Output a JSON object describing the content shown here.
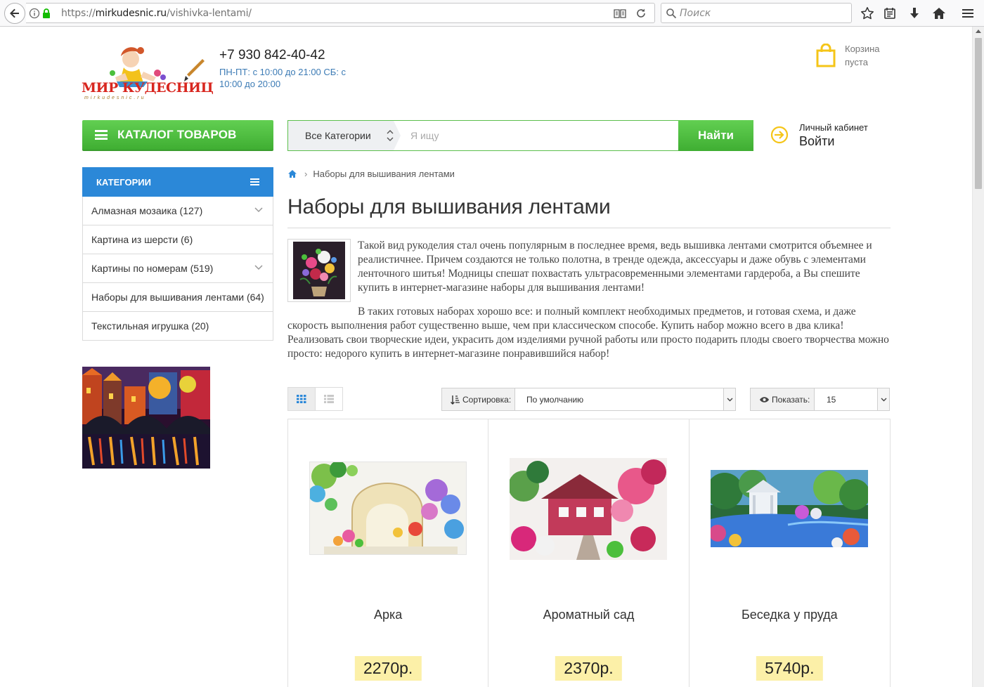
{
  "browser": {
    "url_prefix": "https://",
    "url_domain": "mirkudesnic.ru",
    "url_path": "/vishivka-lentami/",
    "search_placeholder": "Поиск"
  },
  "header": {
    "logo_text": "МИР КУДЕСНИЦ",
    "logo_sub": "mirkudesnic.ru",
    "phone": "+7 930 842-40-42",
    "hours": "ПН-ПТ: с 10:00 до 21:00 СБ: с 10:00 до 20:00",
    "cart_label": "Корзина пуста",
    "catalog_label": "КАТАЛОГ ТОВАРОВ",
    "category_select": "Все Категории",
    "search_placeholder": "Я ищу",
    "find_label": "Найти",
    "cabinet_label": "Личный кабинет",
    "login_label": "Войти"
  },
  "sidebar": {
    "title": "КАТЕГОРИИ",
    "items": [
      {
        "label": "Алмазная мозаика (127)",
        "has_children": true
      },
      {
        "label": "Картина из шерсти (6)",
        "has_children": false
      },
      {
        "label": "Картины по номерам (519)",
        "has_children": true
      },
      {
        "label": "Наборы для вышивания лентами (64)",
        "has_children": false
      },
      {
        "label": "Текстильная игрушка (20)",
        "has_children": false
      }
    ]
  },
  "breadcrumb": {
    "current": "Наборы для вышивания лентами"
  },
  "main": {
    "title": "Наборы для вышивания лентами",
    "desc_p1": "Такой вид рукоделия стал очень популярным в последнее время, ведь вышивка лентами смотрится объемнее и реалистичнее. Причем создаются не только полотна, в тренде одежда, аксессуары и даже обувь с элементами ленточного шитья! Модницы спешат похвастать ультрасовременными элементами гардероба, а Вы спешите купить в интернет-магазине наборы для вышивания лентами!",
    "desc_p2": "В таких готовых наборах хорошо все: и полный комплект необходимых предметов, и готовая схема, и даже скорость выполнения работ существенно выше, чем при классическом способе. Купить набор можно всего в два клика! Реализовать свои творческие идеи, украсить дом изделиями ручной работы или просто подарить плоды своего творчества можно просто: недорого купить в интернет-магазине понравившийся набор!"
  },
  "toolbar": {
    "sort_label": "Сортировка:",
    "sort_value": "По умолчанию",
    "show_label": "Показать:",
    "show_value": "15"
  },
  "products": [
    {
      "name": "Арка",
      "price": "2270р."
    },
    {
      "name": "Ароматный сад",
      "price": "2370р."
    },
    {
      "name": "Беседка у пруда",
      "price": "5740р."
    }
  ],
  "colors": {
    "green": "#4cbf3c",
    "blue": "#2b88d8",
    "link_blue": "#3c7bb5",
    "price_bg": "#fcf0a8",
    "cart_yellow": "#f5c518"
  }
}
